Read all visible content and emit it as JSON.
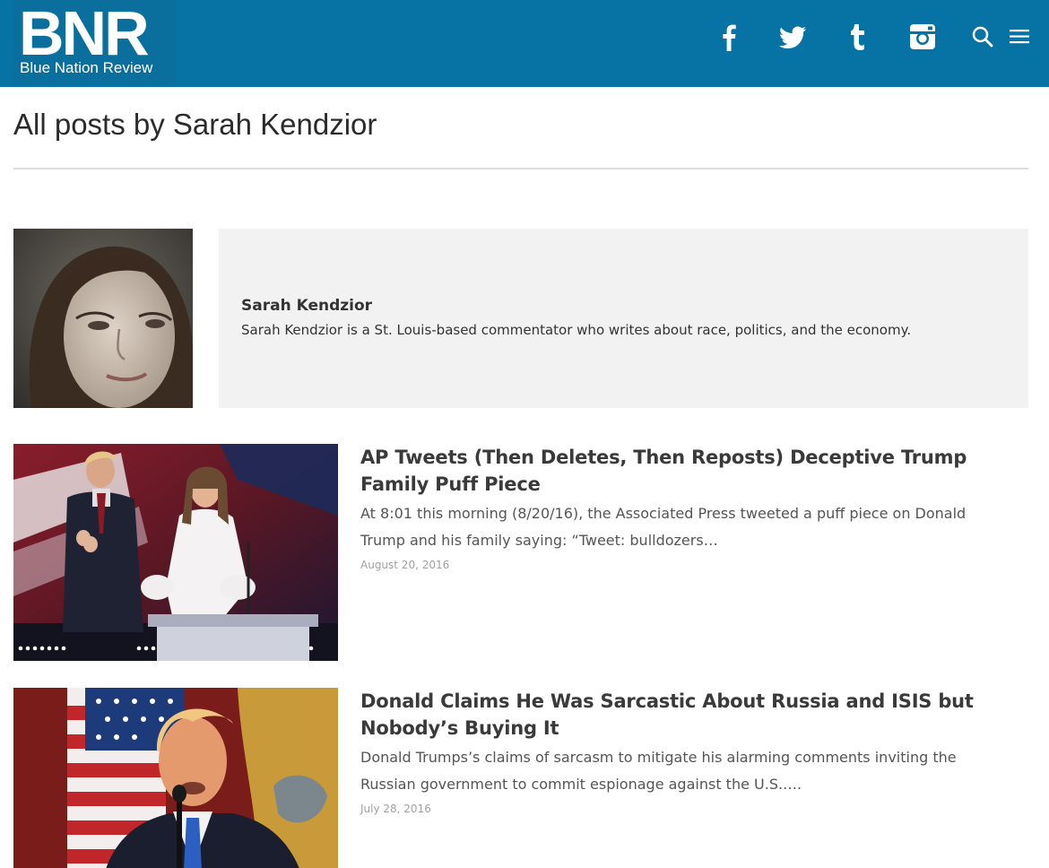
{
  "header": {
    "logo_mark": "BNR",
    "logo_tagline": "Blue Nation Review",
    "social_icons": [
      "facebook-icon",
      "twitter-icon",
      "tumblr-icon",
      "instagram-icon"
    ],
    "action_icons": [
      "search-icon",
      "menu-icon"
    ],
    "background_color": "#0773a4"
  },
  "page": {
    "title": "All posts by Sarah Kendzior"
  },
  "author": {
    "name": "Sarah Kendzior",
    "bio": "Sarah Kendzior is a St. Louis-based commentator who writes about race, politics, and the economy."
  },
  "posts": [
    {
      "title": "AP Tweets (Then Deletes, Then Reposts) Deceptive Trump Family Puff Piece",
      "excerpt": "At 8:01 this morning (8/20/16), the Associated Press tweeted a puff piece on Donald Trump and his family saying: “Tweet: bulldozers…",
      "date": "August 20, 2016"
    },
    {
      "title": "Donald Claims He Was Sarcastic About Russia and ISIS but Nobody’s Buying It",
      "excerpt": "Donald Trumps’s claims of sarcasm to mitigate his alarming comments inviting the Russian government to commit espionage against the U.S.….",
      "date": "July 28, 2016"
    }
  ]
}
